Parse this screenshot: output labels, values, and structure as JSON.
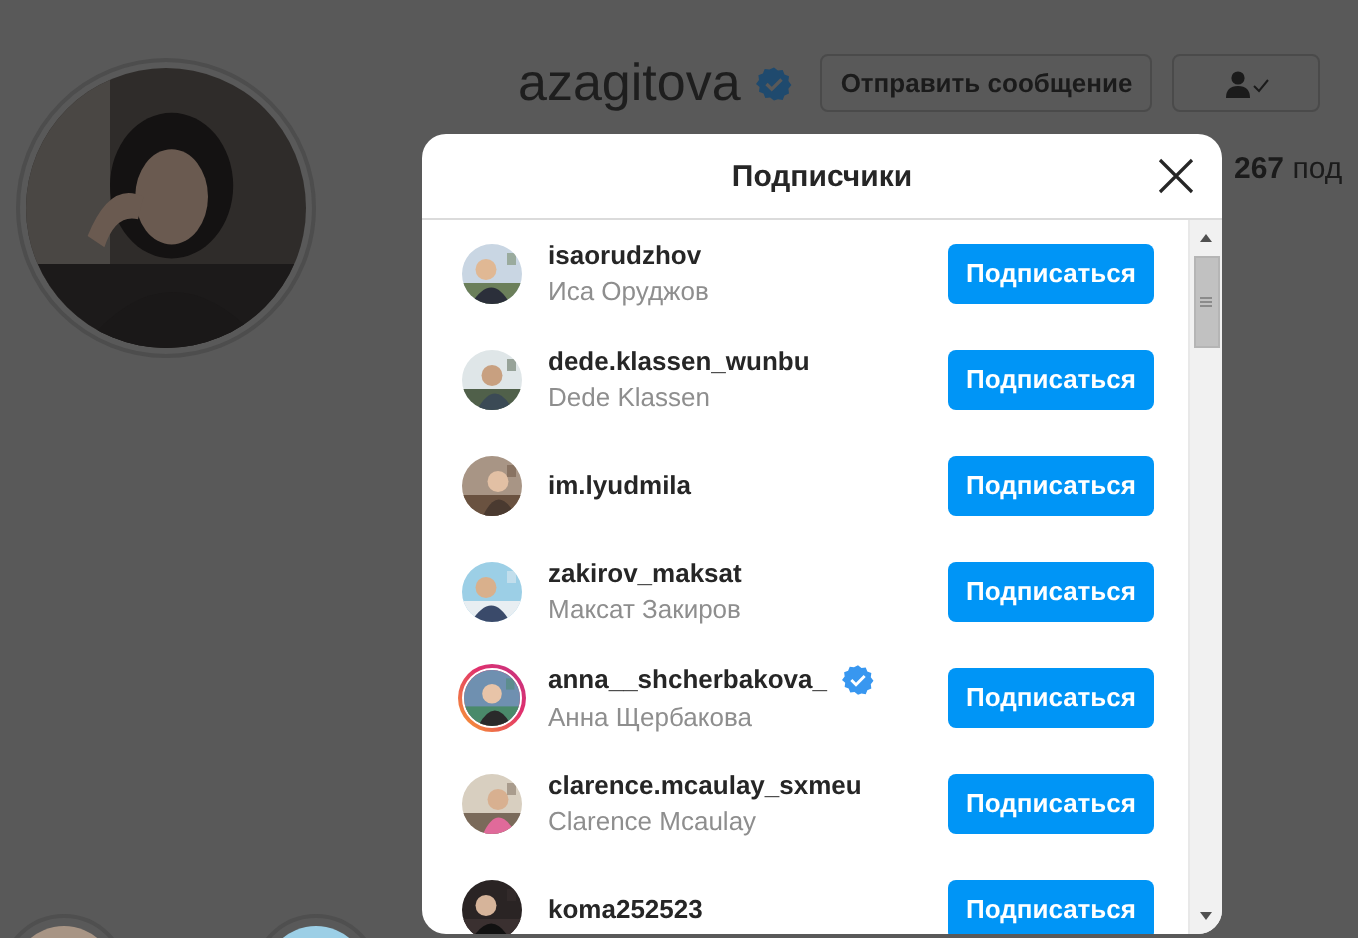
{
  "profile": {
    "username": "azagitova",
    "verified": true,
    "message_button": "Отправить сообщение",
    "stats": [
      {
        "text": "**267** под"
      }
    ]
  },
  "dialog": {
    "title": "Подписчики",
    "followers": [
      {
        "username": "isaorudzhov",
        "full_name": "Иса Оруджов",
        "verified": false,
        "story_ring": false,
        "button": "Подписаться"
      },
      {
        "username": "dede.klassen_wunbu",
        "full_name": "Dede Klassen",
        "verified": false,
        "story_ring": false,
        "button": "Подписаться"
      },
      {
        "username": "im.lyudmila",
        "verified": false,
        "story_ring": false,
        "button": "Подписаться"
      },
      {
        "username": "zakirov_maksat",
        "full_name": "Максат Закиров",
        "verified": false,
        "story_ring": false,
        "button": "Подписаться"
      },
      {
        "username": "anna__shcherbakova_",
        "full_name": "Анна Щербакова",
        "verified": true,
        "story_ring": true,
        "button": "Подписаться"
      },
      {
        "username": "clarence.mcaulay_sxmeu",
        "full_name": "Clarence Mcaulay",
        "verified": false,
        "story_ring": false,
        "button": "Подписаться"
      },
      {
        "username": "koma252523",
        "verified": false,
        "story_ring": false,
        "button": "Подписаться"
      }
    ]
  }
}
